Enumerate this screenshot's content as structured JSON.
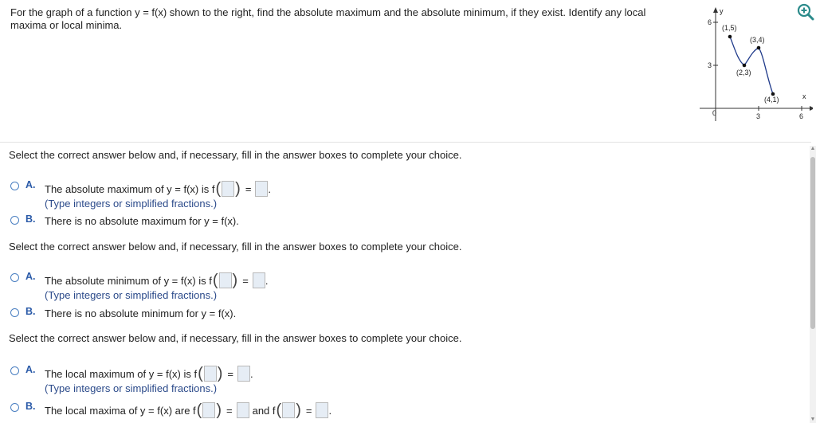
{
  "question": "For the graph of a function y = f(x) shown to the right, find the absolute maximum and the absolute minimum, if they exist. Identify any local maxima or local minima.",
  "graph": {
    "y_axis_label": "y",
    "x_axis_label": "x",
    "y_ticks": [
      "6",
      "3"
    ],
    "x_ticks": [
      "3",
      "6"
    ],
    "origin_label": "0",
    "points": [
      {
        "label": "(1,5)",
        "x": 1,
        "y": 5
      },
      {
        "label": "(2,3)",
        "x": 2,
        "y": 3
      },
      {
        "label": "(3,4)",
        "x": 3,
        "y": 4
      },
      {
        "label": "(4,1)",
        "x": 4,
        "y": 1
      }
    ]
  },
  "instruction": "Select the correct answer below and, if necessary, fill in the answer boxes to complete your choice.",
  "sections": [
    {
      "optA_letter": "A.",
      "optA_pre": "The absolute maximum of y = f(x) is f",
      "optA_hint": "(Type integers or simplified fractions.)",
      "optB_letter": "B.",
      "optB_text": "There is no absolute maximum for y = f(x)."
    },
    {
      "optA_letter": "A.",
      "optA_pre": "The absolute minimum of y = f(x) is f",
      "optA_hint": "(Type integers or simplified fractions.)",
      "optB_letter": "B.",
      "optB_text": "There is no absolute minimum for y = f(x)."
    },
    {
      "optA_letter": "A.",
      "optA_pre": "The local maximum of y = f(x) is f",
      "optA_hint": "(Type integers or simplified fractions.)",
      "optB_letter": "B.",
      "optB_pre": "The local maxima of y = f(x) are f",
      "optB_and": "and f"
    }
  ],
  "symbols": {
    "equals": "=",
    "period": ".",
    "open_paren": "(",
    "close_paren": ")"
  },
  "colors": {
    "accent": "#2a5aa8",
    "hint": "#2b4a8a",
    "box_fill": "#e6edf5"
  },
  "icons": {
    "zoom": "zoom-in-icon"
  }
}
